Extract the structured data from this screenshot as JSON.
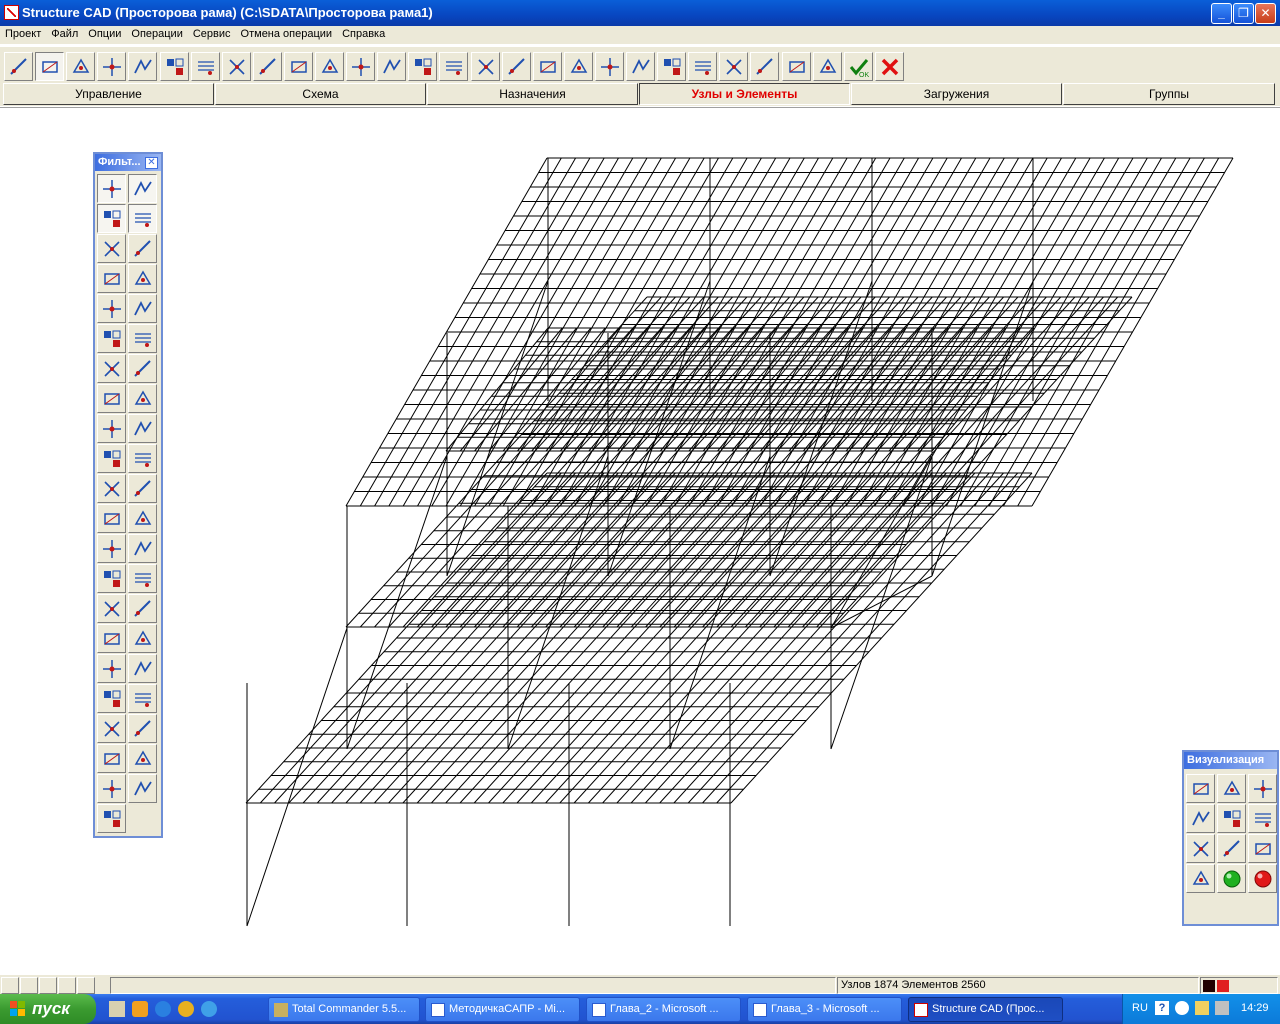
{
  "window": {
    "title": "Structure CAD (Просторова рама) (C:\\SDATA\\Просторова рама1)",
    "minimize_icon": "minimize-icon",
    "restore_icon": "restore-icon",
    "close_icon": "close-icon"
  },
  "menu": [
    "Проект",
    "Файл",
    "Опции",
    "Операции",
    "Сервис",
    "Отмена операции",
    "Справка"
  ],
  "toolbar": {
    "buttons": [
      "node-icon",
      "section-icon",
      "spring-icon",
      "add-node-icon",
      "add-bar-icon",
      "add-plate-icon",
      "add-nodes-icon",
      "add-contour-icon",
      "plane-icon",
      "copy-plane-icon",
      "bar-split-icon",
      "cross-bars-icon",
      "mesh-icon",
      "empty-plate-icon",
      "triangle-icon",
      "grid-icon",
      "route-icon",
      "assemble-icon",
      "pack-icon",
      "contour-icon",
      "select-box-icon",
      "layer-icon",
      "edit-icon",
      "delete-node-icon",
      "delete-element-icon",
      "polyline-icon",
      "copy-icon",
      "ok-icon",
      "cancel-icon"
    ]
  },
  "tabs": [
    {
      "label": "Управление",
      "active": false
    },
    {
      "label": "Схема",
      "active": false
    },
    {
      "label": "Назначения",
      "active": false
    },
    {
      "label": "Узлы и Элементы",
      "active": true
    },
    {
      "label": "Загружения",
      "active": false
    },
    {
      "label": "Группы",
      "active": false
    }
  ],
  "filter_panel": {
    "title": "Фильт...",
    "close_icon": "close-icon"
  },
  "vis_panel": {
    "title": "Визуализация"
  },
  "status": {
    "counts": "Узлов 1874 Элементов 2560"
  },
  "taskbar": {
    "start_label": "пуск",
    "tasks": [
      {
        "label": "Total Commander 5.5...",
        "active": false
      },
      {
        "label": "МетодичкаСАПР - Mi...",
        "active": false
      },
      {
        "label": "Глава_2 - Microsoft ...",
        "active": false
      },
      {
        "label": "Глава_3 - Microsoft ...",
        "active": false
      },
      {
        "label": "Structure CAD (Прос...",
        "active": true
      }
    ],
    "lang": "RU",
    "clock": "14:29"
  },
  "colors": {
    "accent": "#0846c0",
    "tab_active": "#e00000",
    "mesh": "#000000"
  }
}
